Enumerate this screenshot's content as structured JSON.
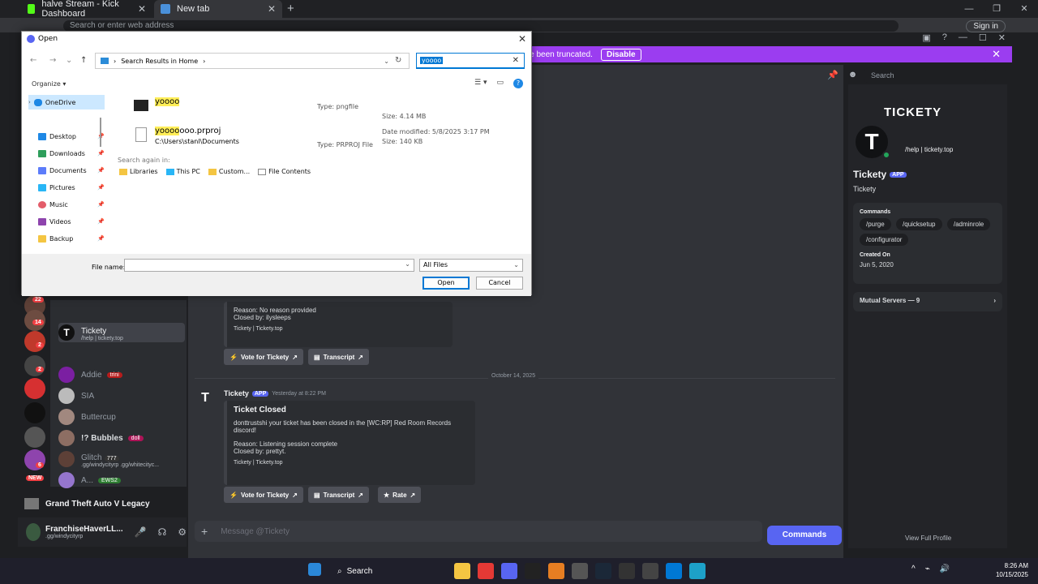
{
  "browser": {
    "tabs": [
      {
        "label": "halve Stream - Kick Dashboard"
      },
      {
        "label": "New tab"
      }
    ],
    "address_placeholder": "Search or enter web address",
    "signin_label": "Sign in"
  },
  "discord": {
    "notice": {
      "text": "have been truncated.",
      "disable_label": "Disable"
    },
    "header_search_placeholder": "Search",
    "dms": [
      {
        "name": "Tickety",
        "sub": "/help | tickety.top"
      },
      {
        "name": "Addie",
        "tag": "trini"
      },
      {
        "name": "SIA"
      },
      {
        "name": "Buttercup"
      },
      {
        "name": "!? Bubbles",
        "tag": "doll"
      },
      {
        "name": "Glitch",
        "tag": "777",
        "sub": ".gg/windycityrp .gg/whitecityc..."
      },
      {
        "name": "A...",
        "tag": "EWS2"
      }
    ],
    "guild_badges": [
      "22",
      "14",
      "2",
      "2",
      "6",
      "NEW"
    ],
    "server_title": "Grand Theft Auto V Legacy",
    "user": {
      "name": "FranchiseHaverLL...",
      "status": ".gg/windycityrp"
    },
    "first_embed": {
      "reason": "Reason: No reason provided",
      "closed_by": "Closed by: ilysleeps",
      "footer": "Tickety | Tickety.top"
    },
    "buttons_row1": [
      "Vote for Tickety",
      "Transcript"
    ],
    "date_divider": "October 14, 2025",
    "message": {
      "author": "Tickety",
      "app_badge": "APP",
      "timestamp": "Yesterday at 8:22 PM",
      "embed_title": "Ticket Closed",
      "embed_body": "donttrustshi your ticket has been closed in the [WC:RP] Red Room Records discord!",
      "reason": "Reason: Listening session complete",
      "closed_by": "Closed by: prettyt.",
      "footer": "Tickety | Tickety.top"
    },
    "buttons_row2": [
      "Vote for Tickety",
      "Transcript",
      "Rate"
    ],
    "composer_placeholder": "Message @Tickety",
    "commands_label": "Commands",
    "profile": {
      "banner": "TICKETY",
      "subname": "/help | tickety.top",
      "name": "Tickety",
      "app_badge": "APP",
      "name2": "Tickety",
      "commands_label": "Commands",
      "commands": [
        "/purge",
        "/quicksetup",
        "/adminrole",
        "/configurator"
      ],
      "created_label": "Created On",
      "created_value": "Jun 5, 2020",
      "mutual": "Mutual Servers — 9",
      "view_full": "View Full Profile"
    }
  },
  "dialog": {
    "title": "Open",
    "path": "Search Results in Home",
    "search_value": "yoooo",
    "organize": "Organize",
    "nav_items": [
      {
        "label": "OneDrive",
        "color": "#1e88e5"
      },
      {
        "label": "Desktop",
        "color": "#1e88e5"
      },
      {
        "label": "Downloads",
        "color": "#2e9e5b"
      },
      {
        "label": "Documents",
        "color": "#5c7cfa"
      },
      {
        "label": "Pictures",
        "color": "#29b6f6"
      },
      {
        "label": "Music",
        "color": "#e35d6a"
      },
      {
        "label": "Videos",
        "color": "#8e44ad"
      },
      {
        "label": "Backup",
        "color": "#f4c542"
      }
    ],
    "files": [
      {
        "name_hl": "yoooo",
        "name_rest": "",
        "type": "Type: pngfile",
        "size": "Size: 4.14 MB"
      },
      {
        "name_hl": "yoooo",
        "name_rest": "ooo.prproj",
        "path": "C:\\Users\\stanl\\Documents",
        "type": "Type: PRPROJ File",
        "modified": "Date modified: 5/8/2025 3:17 PM",
        "size": "Size: 140 KB"
      }
    ],
    "search_again_label": "Search again in:",
    "search_again": [
      "Libraries",
      "This PC",
      "Custom...",
      "File Contents"
    ],
    "file_name_label": "File name:",
    "file_name_value": "",
    "file_type": "All Files",
    "open_label": "Open",
    "cancel_label": "Cancel"
  },
  "taskbar": {
    "search_label": "Search",
    "time": "8:26 AM",
    "date": "10/15/2025"
  }
}
